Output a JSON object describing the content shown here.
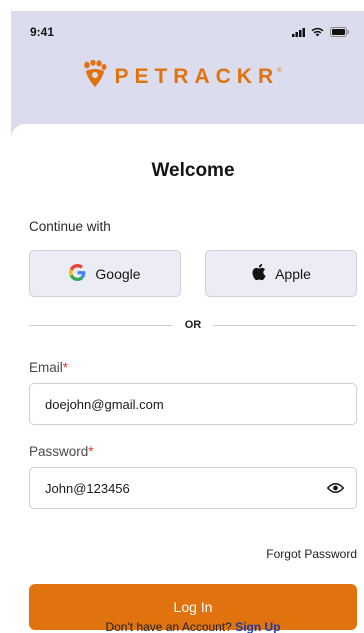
{
  "status_bar": {
    "time": "9:41"
  },
  "brand": {
    "name": "PETRACKR",
    "registered": "®",
    "accent": "#e1730f"
  },
  "screen": {
    "title": "Welcome",
    "continue_with": "Continue with"
  },
  "social": {
    "google_label": "Google",
    "apple_label": "Apple"
  },
  "divider": {
    "label": "OR"
  },
  "form": {
    "email_label": "Email",
    "email_value": "doejohn@gmail.com",
    "password_label": "Password",
    "password_value": "John@123456",
    "required_mark": "*",
    "forgot_label": "Forgot Password",
    "login_label": "Log In"
  },
  "footer": {
    "prompt": "Don't have an Account?",
    "signup_label": "Sign Up"
  },
  "icons": {
    "status": [
      "signal-icon",
      "wifi-icon",
      "battery-icon"
    ],
    "brand": "paw-icon",
    "google": "google-icon",
    "apple": "apple-icon",
    "password_toggle": "eye-icon"
  }
}
